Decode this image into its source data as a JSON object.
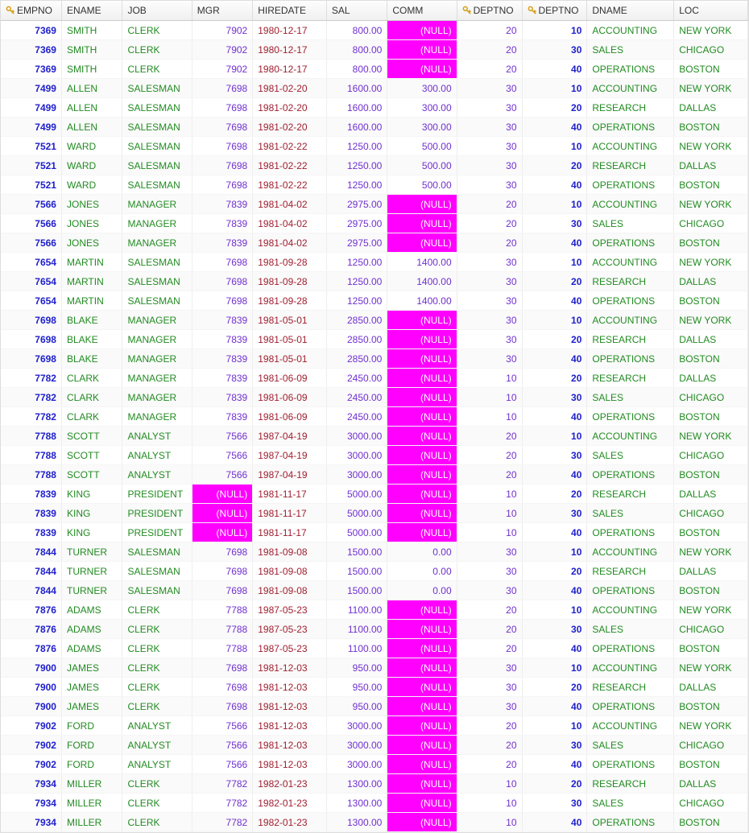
{
  "nullText": "(NULL)",
  "columns": [
    {
      "key": "empno",
      "label": "EMPNO",
      "type": "empno",
      "align": "right",
      "pk": true
    },
    {
      "key": "ename",
      "label": "ENAME",
      "type": "str",
      "align": "left",
      "pk": false
    },
    {
      "key": "job",
      "label": "JOB",
      "type": "str",
      "align": "left",
      "pk": false
    },
    {
      "key": "mgr",
      "label": "MGR",
      "type": "mgr",
      "align": "right",
      "pk": false
    },
    {
      "key": "hiredate",
      "label": "HIREDATE",
      "type": "date",
      "align": "left",
      "pk": false
    },
    {
      "key": "sal",
      "label": "SAL",
      "type": "sal",
      "align": "right",
      "pk": false
    },
    {
      "key": "comm",
      "label": "COMM",
      "type": "comm",
      "align": "right",
      "pk": false
    },
    {
      "key": "deptno1",
      "label": "DEPTNO",
      "type": "deptno1",
      "align": "right",
      "pk": true
    },
    {
      "key": "deptno2",
      "label": "DEPTNO",
      "type": "deptno2",
      "align": "right",
      "pk": true
    },
    {
      "key": "dname",
      "label": "DNAME",
      "type": "str",
      "align": "left",
      "pk": false
    },
    {
      "key": "loc",
      "label": "LOC",
      "type": "str",
      "align": "left",
      "pk": false
    }
  ],
  "rows": [
    {
      "empno": "7369",
      "ename": "SMITH",
      "job": "CLERK",
      "mgr": "7902",
      "hiredate": "1980-12-17",
      "sal": "800.00",
      "comm": null,
      "deptno1": "20",
      "deptno2": "10",
      "dname": "ACCOUNTING",
      "loc": "NEW YORK"
    },
    {
      "empno": "7369",
      "ename": "SMITH",
      "job": "CLERK",
      "mgr": "7902",
      "hiredate": "1980-12-17",
      "sal": "800.00",
      "comm": null,
      "deptno1": "20",
      "deptno2": "30",
      "dname": "SALES",
      "loc": "CHICAGO"
    },
    {
      "empno": "7369",
      "ename": "SMITH",
      "job": "CLERK",
      "mgr": "7902",
      "hiredate": "1980-12-17",
      "sal": "800.00",
      "comm": null,
      "deptno1": "20",
      "deptno2": "40",
      "dname": "OPERATIONS",
      "loc": "BOSTON"
    },
    {
      "empno": "7499",
      "ename": "ALLEN",
      "job": "SALESMAN",
      "mgr": "7698",
      "hiredate": "1981-02-20",
      "sal": "1600.00",
      "comm": "300.00",
      "deptno1": "30",
      "deptno2": "10",
      "dname": "ACCOUNTING",
      "loc": "NEW YORK"
    },
    {
      "empno": "7499",
      "ename": "ALLEN",
      "job": "SALESMAN",
      "mgr": "7698",
      "hiredate": "1981-02-20",
      "sal": "1600.00",
      "comm": "300.00",
      "deptno1": "30",
      "deptno2": "20",
      "dname": "RESEARCH",
      "loc": "DALLAS"
    },
    {
      "empno": "7499",
      "ename": "ALLEN",
      "job": "SALESMAN",
      "mgr": "7698",
      "hiredate": "1981-02-20",
      "sal": "1600.00",
      "comm": "300.00",
      "deptno1": "30",
      "deptno2": "40",
      "dname": "OPERATIONS",
      "loc": "BOSTON"
    },
    {
      "empno": "7521",
      "ename": "WARD",
      "job": "SALESMAN",
      "mgr": "7698",
      "hiredate": "1981-02-22",
      "sal": "1250.00",
      "comm": "500.00",
      "deptno1": "30",
      "deptno2": "10",
      "dname": "ACCOUNTING",
      "loc": "NEW YORK"
    },
    {
      "empno": "7521",
      "ename": "WARD",
      "job": "SALESMAN",
      "mgr": "7698",
      "hiredate": "1981-02-22",
      "sal": "1250.00",
      "comm": "500.00",
      "deptno1": "30",
      "deptno2": "20",
      "dname": "RESEARCH",
      "loc": "DALLAS"
    },
    {
      "empno": "7521",
      "ename": "WARD",
      "job": "SALESMAN",
      "mgr": "7698",
      "hiredate": "1981-02-22",
      "sal": "1250.00",
      "comm": "500.00",
      "deptno1": "30",
      "deptno2": "40",
      "dname": "OPERATIONS",
      "loc": "BOSTON"
    },
    {
      "empno": "7566",
      "ename": "JONES",
      "job": "MANAGER",
      "mgr": "7839",
      "hiredate": "1981-04-02",
      "sal": "2975.00",
      "comm": null,
      "deptno1": "20",
      "deptno2": "10",
      "dname": "ACCOUNTING",
      "loc": "NEW YORK"
    },
    {
      "empno": "7566",
      "ename": "JONES",
      "job": "MANAGER",
      "mgr": "7839",
      "hiredate": "1981-04-02",
      "sal": "2975.00",
      "comm": null,
      "deptno1": "20",
      "deptno2": "30",
      "dname": "SALES",
      "loc": "CHICAGO"
    },
    {
      "empno": "7566",
      "ename": "JONES",
      "job": "MANAGER",
      "mgr": "7839",
      "hiredate": "1981-04-02",
      "sal": "2975.00",
      "comm": null,
      "deptno1": "20",
      "deptno2": "40",
      "dname": "OPERATIONS",
      "loc": "BOSTON"
    },
    {
      "empno": "7654",
      "ename": "MARTIN",
      "job": "SALESMAN",
      "mgr": "7698",
      "hiredate": "1981-09-28",
      "sal": "1250.00",
      "comm": "1400.00",
      "deptno1": "30",
      "deptno2": "10",
      "dname": "ACCOUNTING",
      "loc": "NEW YORK"
    },
    {
      "empno": "7654",
      "ename": "MARTIN",
      "job": "SALESMAN",
      "mgr": "7698",
      "hiredate": "1981-09-28",
      "sal": "1250.00",
      "comm": "1400.00",
      "deptno1": "30",
      "deptno2": "20",
      "dname": "RESEARCH",
      "loc": "DALLAS"
    },
    {
      "empno": "7654",
      "ename": "MARTIN",
      "job": "SALESMAN",
      "mgr": "7698",
      "hiredate": "1981-09-28",
      "sal": "1250.00",
      "comm": "1400.00",
      "deptno1": "30",
      "deptno2": "40",
      "dname": "OPERATIONS",
      "loc": "BOSTON"
    },
    {
      "empno": "7698",
      "ename": "BLAKE",
      "job": "MANAGER",
      "mgr": "7839",
      "hiredate": "1981-05-01",
      "sal": "2850.00",
      "comm": null,
      "deptno1": "30",
      "deptno2": "10",
      "dname": "ACCOUNTING",
      "loc": "NEW YORK"
    },
    {
      "empno": "7698",
      "ename": "BLAKE",
      "job": "MANAGER",
      "mgr": "7839",
      "hiredate": "1981-05-01",
      "sal": "2850.00",
      "comm": null,
      "deptno1": "30",
      "deptno2": "20",
      "dname": "RESEARCH",
      "loc": "DALLAS"
    },
    {
      "empno": "7698",
      "ename": "BLAKE",
      "job": "MANAGER",
      "mgr": "7839",
      "hiredate": "1981-05-01",
      "sal": "2850.00",
      "comm": null,
      "deptno1": "30",
      "deptno2": "40",
      "dname": "OPERATIONS",
      "loc": "BOSTON"
    },
    {
      "empno": "7782",
      "ename": "CLARK",
      "job": "MANAGER",
      "mgr": "7839",
      "hiredate": "1981-06-09",
      "sal": "2450.00",
      "comm": null,
      "deptno1": "10",
      "deptno2": "20",
      "dname": "RESEARCH",
      "loc": "DALLAS"
    },
    {
      "empno": "7782",
      "ename": "CLARK",
      "job": "MANAGER",
      "mgr": "7839",
      "hiredate": "1981-06-09",
      "sal": "2450.00",
      "comm": null,
      "deptno1": "10",
      "deptno2": "30",
      "dname": "SALES",
      "loc": "CHICAGO"
    },
    {
      "empno": "7782",
      "ename": "CLARK",
      "job": "MANAGER",
      "mgr": "7839",
      "hiredate": "1981-06-09",
      "sal": "2450.00",
      "comm": null,
      "deptno1": "10",
      "deptno2": "40",
      "dname": "OPERATIONS",
      "loc": "BOSTON"
    },
    {
      "empno": "7788",
      "ename": "SCOTT",
      "job": "ANALYST",
      "mgr": "7566",
      "hiredate": "1987-04-19",
      "sal": "3000.00",
      "comm": null,
      "deptno1": "20",
      "deptno2": "10",
      "dname": "ACCOUNTING",
      "loc": "NEW YORK"
    },
    {
      "empno": "7788",
      "ename": "SCOTT",
      "job": "ANALYST",
      "mgr": "7566",
      "hiredate": "1987-04-19",
      "sal": "3000.00",
      "comm": null,
      "deptno1": "20",
      "deptno2": "30",
      "dname": "SALES",
      "loc": "CHICAGO"
    },
    {
      "empno": "7788",
      "ename": "SCOTT",
      "job": "ANALYST",
      "mgr": "7566",
      "hiredate": "1987-04-19",
      "sal": "3000.00",
      "comm": null,
      "deptno1": "20",
      "deptno2": "40",
      "dname": "OPERATIONS",
      "loc": "BOSTON"
    },
    {
      "empno": "7839",
      "ename": "KING",
      "job": "PRESIDENT",
      "mgr": null,
      "hiredate": "1981-11-17",
      "sal": "5000.00",
      "comm": null,
      "deptno1": "10",
      "deptno2": "20",
      "dname": "RESEARCH",
      "loc": "DALLAS"
    },
    {
      "empno": "7839",
      "ename": "KING",
      "job": "PRESIDENT",
      "mgr": null,
      "hiredate": "1981-11-17",
      "sal": "5000.00",
      "comm": null,
      "deptno1": "10",
      "deptno2": "30",
      "dname": "SALES",
      "loc": "CHICAGO"
    },
    {
      "empno": "7839",
      "ename": "KING",
      "job": "PRESIDENT",
      "mgr": null,
      "hiredate": "1981-11-17",
      "sal": "5000.00",
      "comm": null,
      "deptno1": "10",
      "deptno2": "40",
      "dname": "OPERATIONS",
      "loc": "BOSTON"
    },
    {
      "empno": "7844",
      "ename": "TURNER",
      "job": "SALESMAN",
      "mgr": "7698",
      "hiredate": "1981-09-08",
      "sal": "1500.00",
      "comm": "0.00",
      "deptno1": "30",
      "deptno2": "10",
      "dname": "ACCOUNTING",
      "loc": "NEW YORK"
    },
    {
      "empno": "7844",
      "ename": "TURNER",
      "job": "SALESMAN",
      "mgr": "7698",
      "hiredate": "1981-09-08",
      "sal": "1500.00",
      "comm": "0.00",
      "deptno1": "30",
      "deptno2": "20",
      "dname": "RESEARCH",
      "loc": "DALLAS"
    },
    {
      "empno": "7844",
      "ename": "TURNER",
      "job": "SALESMAN",
      "mgr": "7698",
      "hiredate": "1981-09-08",
      "sal": "1500.00",
      "comm": "0.00",
      "deptno1": "30",
      "deptno2": "40",
      "dname": "OPERATIONS",
      "loc": "BOSTON"
    },
    {
      "empno": "7876",
      "ename": "ADAMS",
      "job": "CLERK",
      "mgr": "7788",
      "hiredate": "1987-05-23",
      "sal": "1100.00",
      "comm": null,
      "deptno1": "20",
      "deptno2": "10",
      "dname": "ACCOUNTING",
      "loc": "NEW YORK"
    },
    {
      "empno": "7876",
      "ename": "ADAMS",
      "job": "CLERK",
      "mgr": "7788",
      "hiredate": "1987-05-23",
      "sal": "1100.00",
      "comm": null,
      "deptno1": "20",
      "deptno2": "30",
      "dname": "SALES",
      "loc": "CHICAGO"
    },
    {
      "empno": "7876",
      "ename": "ADAMS",
      "job": "CLERK",
      "mgr": "7788",
      "hiredate": "1987-05-23",
      "sal": "1100.00",
      "comm": null,
      "deptno1": "20",
      "deptno2": "40",
      "dname": "OPERATIONS",
      "loc": "BOSTON"
    },
    {
      "empno": "7900",
      "ename": "JAMES",
      "job": "CLERK",
      "mgr": "7698",
      "hiredate": "1981-12-03",
      "sal": "950.00",
      "comm": null,
      "deptno1": "30",
      "deptno2": "10",
      "dname": "ACCOUNTING",
      "loc": "NEW YORK"
    },
    {
      "empno": "7900",
      "ename": "JAMES",
      "job": "CLERK",
      "mgr": "7698",
      "hiredate": "1981-12-03",
      "sal": "950.00",
      "comm": null,
      "deptno1": "30",
      "deptno2": "20",
      "dname": "RESEARCH",
      "loc": "DALLAS"
    },
    {
      "empno": "7900",
      "ename": "JAMES",
      "job": "CLERK",
      "mgr": "7698",
      "hiredate": "1981-12-03",
      "sal": "950.00",
      "comm": null,
      "deptno1": "30",
      "deptno2": "40",
      "dname": "OPERATIONS",
      "loc": "BOSTON"
    },
    {
      "empno": "7902",
      "ename": "FORD",
      "job": "ANALYST",
      "mgr": "7566",
      "hiredate": "1981-12-03",
      "sal": "3000.00",
      "comm": null,
      "deptno1": "20",
      "deptno2": "10",
      "dname": "ACCOUNTING",
      "loc": "NEW YORK"
    },
    {
      "empno": "7902",
      "ename": "FORD",
      "job": "ANALYST",
      "mgr": "7566",
      "hiredate": "1981-12-03",
      "sal": "3000.00",
      "comm": null,
      "deptno1": "20",
      "deptno2": "30",
      "dname": "SALES",
      "loc": "CHICAGO"
    },
    {
      "empno": "7902",
      "ename": "FORD",
      "job": "ANALYST",
      "mgr": "7566",
      "hiredate": "1981-12-03",
      "sal": "3000.00",
      "comm": null,
      "deptno1": "20",
      "deptno2": "40",
      "dname": "OPERATIONS",
      "loc": "BOSTON"
    },
    {
      "empno": "7934",
      "ename": "MILLER",
      "job": "CLERK",
      "mgr": "7782",
      "hiredate": "1982-01-23",
      "sal": "1300.00",
      "comm": null,
      "deptno1": "10",
      "deptno2": "20",
      "dname": "RESEARCH",
      "loc": "DALLAS"
    },
    {
      "empno": "7934",
      "ename": "MILLER",
      "job": "CLERK",
      "mgr": "7782",
      "hiredate": "1982-01-23",
      "sal": "1300.00",
      "comm": null,
      "deptno1": "10",
      "deptno2": "30",
      "dname": "SALES",
      "loc": "CHICAGO"
    },
    {
      "empno": "7934",
      "ename": "MILLER",
      "job": "CLERK",
      "mgr": "7782",
      "hiredate": "1982-01-23",
      "sal": "1300.00",
      "comm": null,
      "deptno1": "10",
      "deptno2": "40",
      "dname": "OPERATIONS",
      "loc": "BOSTON"
    }
  ]
}
